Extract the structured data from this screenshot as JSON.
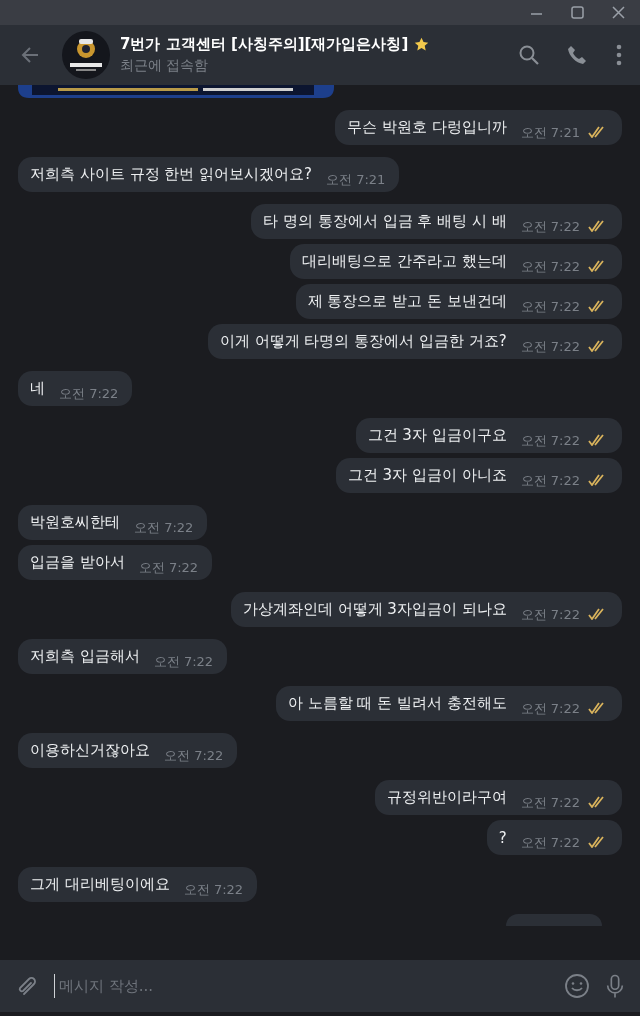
{
  "window": {
    "controls": [
      {
        "kind": "minimize"
      },
      {
        "kind": "maximize"
      },
      {
        "kind": "close"
      }
    ]
  },
  "header": {
    "title": "7번가 고객센터 [사칭주의][재가입은사칭]",
    "starred": true,
    "status": "최근에 접속함"
  },
  "messages": [
    {
      "kind": "picture",
      "outgoing": false
    },
    {
      "kind": "text",
      "outgoing": true,
      "text": "무슨 박원호 다렁입니까",
      "time": "오전 7:21",
      "read": true
    },
    {
      "kind": "text",
      "outgoing": false,
      "text": "저희측 사이트 규정 한번 읽어보시겠어요?",
      "time": "오전 7:21"
    },
    {
      "kind": "text",
      "outgoing": true,
      "text": "타 명의 통장에서 입금 후 배팅 시 배",
      "time": "오전 7:22",
      "read": true
    },
    {
      "kind": "text",
      "outgoing": true,
      "text": "대리배팅으로 간주라고 했는데",
      "time": "오전 7:22",
      "read": true
    },
    {
      "kind": "text",
      "outgoing": true,
      "text": "제 통장으로 받고 돈 보낸건데",
      "time": "오전 7:22",
      "read": true
    },
    {
      "kind": "text",
      "outgoing": true,
      "text": "이게 어떻게 타명의 통장에서 입금한 거죠?",
      "time": "오전 7:22",
      "read": true
    },
    {
      "kind": "text",
      "outgoing": false,
      "text": "네",
      "time": "오전 7:22"
    },
    {
      "kind": "text",
      "outgoing": true,
      "text": "그건 3자 입금이구요",
      "time": "오전 7:22",
      "read": true
    },
    {
      "kind": "text",
      "outgoing": true,
      "text": "그건 3자 입금이 아니죠",
      "time": "오전 7:22",
      "read": true
    },
    {
      "kind": "text",
      "outgoing": false,
      "text": "박원호씨한테",
      "time": "오전 7:22"
    },
    {
      "kind": "text",
      "outgoing": false,
      "text": "입금을 받아서",
      "time": "오전 7:22"
    },
    {
      "kind": "text",
      "outgoing": true,
      "text": "가상계좌인데 어떻게 3자입금이 되나요",
      "time": "오전 7:22",
      "read": true
    },
    {
      "kind": "text",
      "outgoing": false,
      "text": "저희측 입금해서",
      "time": "오전 7:22"
    },
    {
      "kind": "text",
      "outgoing": true,
      "text": "아 노름할 때 돈 빌려서 충전해도",
      "time": "오전 7:22",
      "read": true
    },
    {
      "kind": "text",
      "outgoing": false,
      "text": "이용하신거잖아요",
      "time": "오전 7:22"
    },
    {
      "kind": "text",
      "outgoing": true,
      "text": "규정위반이라구여",
      "time": "오전 7:22",
      "read": true
    },
    {
      "kind": "text",
      "outgoing": true,
      "text": "?",
      "time": "오전 7:22",
      "read": true
    },
    {
      "kind": "text",
      "outgoing": false,
      "text": "그게 대리베팅이에요",
      "time": "오전 7:22"
    },
    {
      "kind": "partial",
      "outgoing": true
    }
  ],
  "composer": {
    "placeholder": "메시지 작성..."
  }
}
